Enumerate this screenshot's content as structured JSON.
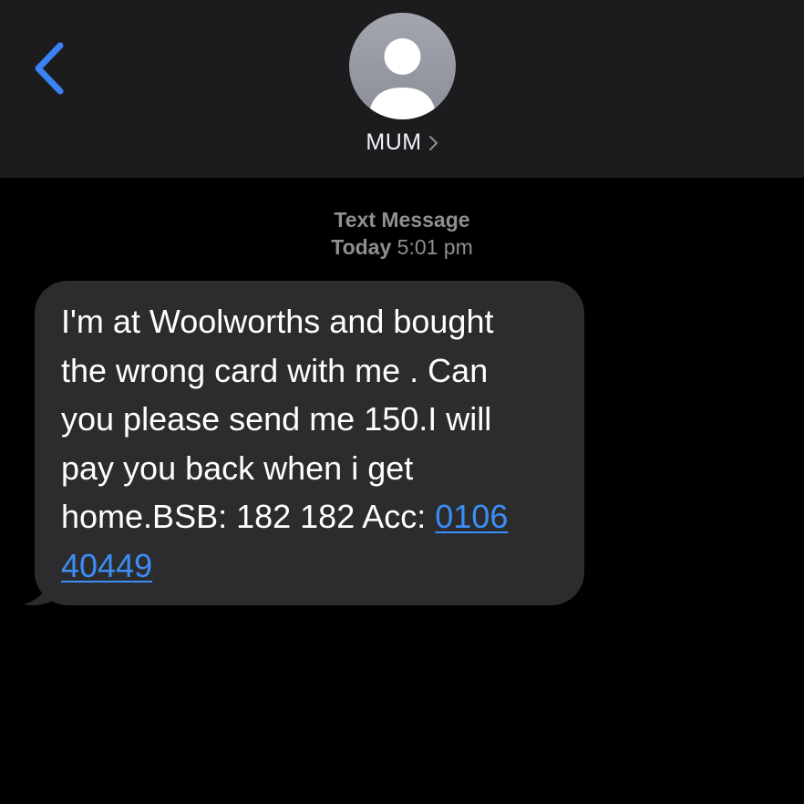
{
  "colors": {
    "header_background": "#1c1c1e",
    "background": "#000000",
    "bubble_background": "#2c2c2e",
    "link": "#3b8ef6",
    "back_chevron": "#3b82f6",
    "meta_text": "#8e8e93"
  },
  "header": {
    "back_icon": "chevron-left-icon",
    "avatar_icon": "person-silhouette-icon",
    "contact_name": "MUM",
    "contact_chevron_icon": "chevron-right-icon"
  },
  "conversation": {
    "message_type": "Text Message",
    "timestamp_day": "Today",
    "timestamp_time": "5:01 pm",
    "messages": [
      {
        "direction": "incoming",
        "lines": [
          "I'm at Woolworths and bought",
          "the wrong card with me . Can",
          "you please send me 150.I will",
          "pay you back when i get"
        ],
        "last_line_prefix": "home.BSB: 182 182 Acc: ",
        "account_link_part1": "0106",
        "account_link_part2": "40449"
      }
    ]
  }
}
